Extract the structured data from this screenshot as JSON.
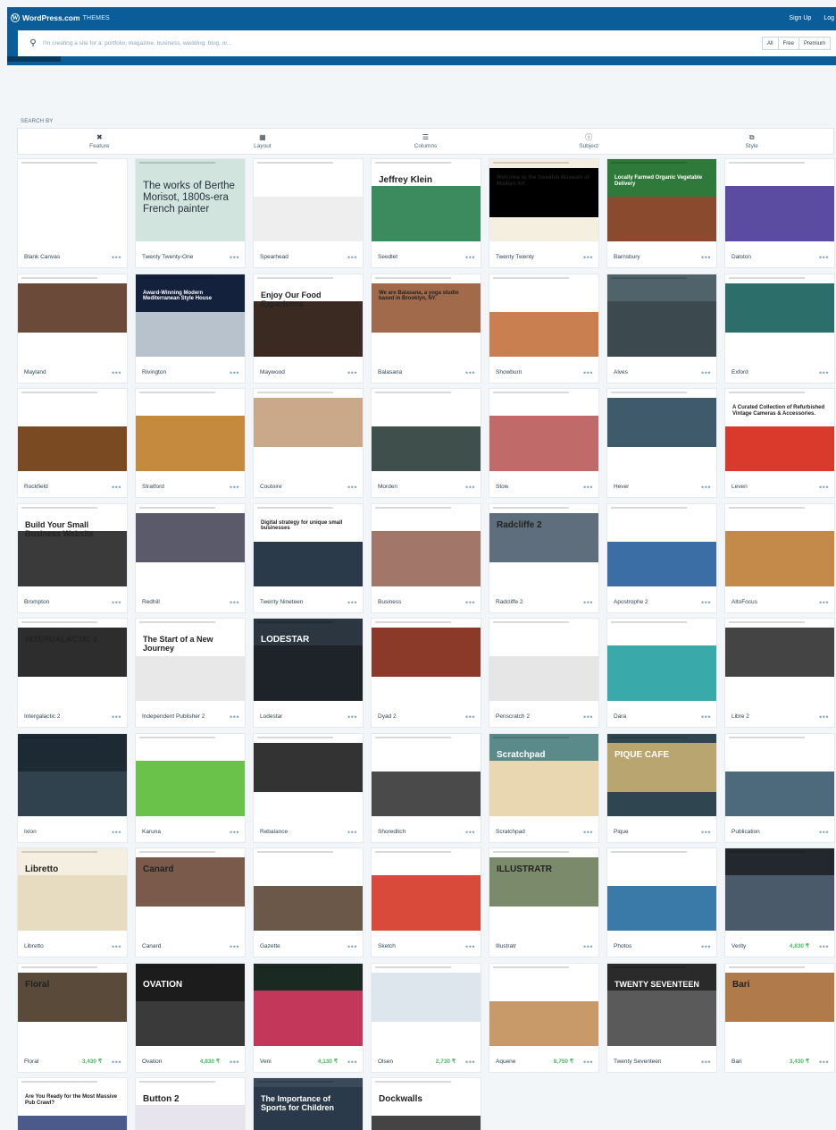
{
  "masthead": {
    "brand": "WordPress.com",
    "section": "THEMES",
    "links": [
      "Sign Up",
      "Log"
    ],
    "search_placeholder": "I'm creating a site for a: portfolio, magazine, business, wedding, blog, or...",
    "filters": [
      "All",
      "Free",
      "Premium"
    ]
  },
  "search_by": {
    "label": "SEARCH BY",
    "items": [
      {
        "label": "Feature",
        "icon": "tools-icon"
      },
      {
        "label": "Layout",
        "icon": "layout-icon"
      },
      {
        "label": "Columns",
        "icon": "columns-icon"
      },
      {
        "label": "Subject",
        "icon": "info-icon"
      },
      {
        "label": "Style",
        "icon": "style-icon"
      }
    ]
  },
  "themes": [
    {
      "name": "Blank Canvas",
      "price": "",
      "preview": {
        "bg": "#ffffff",
        "accent": "#ffffff"
      }
    },
    {
      "name": "Twenty Twenty-One",
      "price": "",
      "preview": {
        "bg": "#d1e4dd",
        "accent": "#d1e4dd",
        "text": "The works of Berthe Morisot, 1800s-era French painter"
      }
    },
    {
      "name": "Spearhead",
      "price": "",
      "preview": {
        "bg": "#ffffff",
        "accent": "#eeeeee"
      }
    },
    {
      "name": "Seedlet",
      "price": "",
      "preview": {
        "bg": "#ffffff",
        "accent": "#3c8b5f",
        "text": "Jeffrey Klein"
      }
    },
    {
      "name": "Twenty Twenty",
      "price": "",
      "preview": {
        "bg": "#f5efe0",
        "accent": "#000000",
        "text": "Welcome to the Swedish Museum of Modern Art"
      }
    },
    {
      "name": "Barnsbury",
      "price": "",
      "preview": {
        "bg": "#2f7a3b",
        "accent": "#8a4a2e",
        "text": "Locally Farmed Organic Vegetable Delivery"
      }
    },
    {
      "name": "Dalston",
      "price": "",
      "preview": {
        "bg": "#ffffff",
        "accent": "#5b4ba1"
      }
    },
    {
      "name": "Mayland",
      "price": "",
      "preview": {
        "bg": "#ffffff",
        "accent": "#6b4a3a"
      }
    },
    {
      "name": "Rivington",
      "price": "",
      "preview": {
        "bg": "#14213d",
        "accent": "#b8c2cc",
        "text": "Award-Winning Modern Mediterranean Style House"
      }
    },
    {
      "name": "Maywood",
      "price": "",
      "preview": {
        "bg": "#ffffff",
        "accent": "#3b2a22",
        "text": "Enjoy Our Food Experience"
      }
    },
    {
      "name": "Balasana",
      "price": "",
      "preview": {
        "bg": "#ffffff",
        "accent": "#a06a4b",
        "text": "We are Balasana, a yoga studio based in Brooklyn, NY."
      }
    },
    {
      "name": "Showburn",
      "price": "",
      "preview": {
        "bg": "#ffffff",
        "accent": "#c97f4f"
      }
    },
    {
      "name": "Alves",
      "price": "",
      "preview": {
        "bg": "#50626a",
        "accent": "#3c4a50"
      }
    },
    {
      "name": "Exford",
      "price": "",
      "preview": {
        "bg": "#ffffff",
        "accent": "#2c6e6a"
      }
    },
    {
      "name": "Rockfield",
      "price": "",
      "preview": {
        "bg": "#ffffff",
        "accent": "#7a4a22"
      }
    },
    {
      "name": "Stratford",
      "price": "",
      "preview": {
        "bg": "#ffffff",
        "accent": "#c58a3d"
      }
    },
    {
      "name": "Coutoire",
      "price": "",
      "preview": {
        "bg": "#ffffff",
        "accent": "#caa98a"
      }
    },
    {
      "name": "Morden",
      "price": "",
      "preview": {
        "bg": "#ffffff",
        "accent": "#3e4f4c"
      }
    },
    {
      "name": "Stow",
      "price": "",
      "preview": {
        "bg": "#ffffff",
        "accent": "#c06a6a"
      }
    },
    {
      "name": "Hever",
      "price": "",
      "preview": {
        "bg": "#ffffff",
        "accent": "#3f5a6b"
      }
    },
    {
      "name": "Leven",
      "price": "",
      "preview": {
        "bg": "#ffffff",
        "accent": "#d93a2b",
        "text": "A Curated Collection of Refurbished Vintage Cameras & Accessories."
      }
    },
    {
      "name": "Brompton",
      "price": "",
      "preview": {
        "bg": "#ffffff",
        "accent": "#3a3a3a",
        "text": "Build Your Small Business Website"
      }
    },
    {
      "name": "Redhill",
      "price": "",
      "preview": {
        "bg": "#ffffff",
        "accent": "#5a5a6a"
      }
    },
    {
      "name": "Twenty Nineteen",
      "price": "",
      "preview": {
        "bg": "#ffffff",
        "accent": "#2a3a4a",
        "text": "Digital strategy for unique small businesses"
      }
    },
    {
      "name": "Business",
      "price": "",
      "preview": {
        "bg": "#ffffff",
        "accent": "#a2776a"
      }
    },
    {
      "name": "Radcliffe 2",
      "price": "",
      "preview": {
        "bg": "#ffffff",
        "accent": "#5e6e7c",
        "text": "Radcliffe 2"
      }
    },
    {
      "name": "Apostrophe 2",
      "price": "",
      "preview": {
        "bg": "#ffffff",
        "accent": "#3a6ea5"
      }
    },
    {
      "name": "AltoFocus",
      "price": "",
      "preview": {
        "bg": "#ffffff",
        "accent": "#c48a4a"
      }
    },
    {
      "name": "Intergalactic 2",
      "price": "",
      "preview": {
        "bg": "#ffffff",
        "accent": "#2d2d2d",
        "text": "INTERGALACTIC 2"
      }
    },
    {
      "name": "Independent Publisher 2",
      "price": "",
      "preview": {
        "bg": "#ffffff",
        "accent": "#e8e8e8",
        "text": "The Start of a New Journey"
      }
    },
    {
      "name": "Lodestar",
      "price": "",
      "preview": {
        "bg": "#2b3640",
        "accent": "#1d2329",
        "text": "LODESTAR"
      }
    },
    {
      "name": "Dyad 2",
      "price": "",
      "preview": {
        "bg": "#ffffff",
        "accent": "#8b3a2a"
      }
    },
    {
      "name": "Penscratch 2",
      "price": "",
      "preview": {
        "bg": "#ffffff",
        "accent": "#e6e6e6"
      }
    },
    {
      "name": "Dara",
      "price": "",
      "preview": {
        "bg": "#ffffff",
        "accent": "#3aa9a9"
      }
    },
    {
      "name": "Libre 2",
      "price": "",
      "preview": {
        "bg": "#ffffff",
        "accent": "#444444"
      }
    },
    {
      "name": "Ixion",
      "price": "",
      "preview": {
        "bg": "#1d2a33",
        "accent": "#31424f"
      }
    },
    {
      "name": "Karuna",
      "price": "",
      "preview": {
        "bg": "#ffffff",
        "accent": "#6ac24a"
      }
    },
    {
      "name": "Rebalance",
      "price": "",
      "preview": {
        "bg": "#ffffff",
        "accent": "#333333"
      }
    },
    {
      "name": "Shoreditch",
      "price": "",
      "preview": {
        "bg": "#ffffff",
        "accent": "#4a4a4a"
      }
    },
    {
      "name": "Scratchpad",
      "price": "",
      "preview": {
        "bg": "#5a8a8a",
        "accent": "#e8d7b0",
        "text": "Scratchpad"
      }
    },
    {
      "name": "Pique",
      "price": "",
      "preview": {
        "bg": "#2f4550",
        "accent": "#b9a570",
        "text": "PIQUE CAFE"
      }
    },
    {
      "name": "Publication",
      "price": "",
      "preview": {
        "bg": "#ffffff",
        "accent": "#4c6a7b"
      }
    },
    {
      "name": "Libretto",
      "price": "",
      "preview": {
        "bg": "#f4efe0",
        "accent": "#e8dcc0",
        "text": "Libretto"
      }
    },
    {
      "name": "Canard",
      "price": "",
      "preview": {
        "bg": "#ffffff",
        "accent": "#7a5a4a",
        "text": "Canard"
      }
    },
    {
      "name": "Gazette",
      "price": "",
      "preview": {
        "bg": "#ffffff",
        "accent": "#6b5848"
      }
    },
    {
      "name": "Sketch",
      "price": "",
      "preview": {
        "bg": "#ffffff",
        "accent": "#d94a3a"
      }
    },
    {
      "name": "Illustratr",
      "price": "",
      "preview": {
        "bg": "#ffffff",
        "accent": "#7a8a6a",
        "text": "ILLUSTRATR"
      }
    },
    {
      "name": "Photos",
      "price": "",
      "preview": {
        "bg": "#ffffff",
        "accent": "#3a7aa8"
      }
    },
    {
      "name": "Verity",
      "price": "4,830 ₹",
      "preview": {
        "bg": "#22282e",
        "accent": "#4a5a6a"
      }
    },
    {
      "name": "Floral",
      "price": "3,430 ₹",
      "preview": {
        "bg": "#ffffff",
        "accent": "#5a4a3a",
        "text": "Floral"
      }
    },
    {
      "name": "Ovation",
      "price": "4,830 ₹",
      "preview": {
        "bg": "#1c1c1c",
        "accent": "#3a3a3a",
        "text": "OVATION"
      }
    },
    {
      "name": "Veni",
      "price": "4,130 ₹",
      "preview": {
        "bg": "#1a2a22",
        "accent": "#c2375a"
      }
    },
    {
      "name": "Olsen",
      "price": "2,730 ₹",
      "preview": {
        "bg": "#ffffff",
        "accent": "#dde6ec"
      }
    },
    {
      "name": "Aquene",
      "price": "8,750 ₹",
      "preview": {
        "bg": "#ffffff",
        "accent": "#c89a6a"
      }
    },
    {
      "name": "Twenty Seventeen",
      "price": "",
      "preview": {
        "bg": "#2a2a2a",
        "accent": "#5a5a5a",
        "text": "TWENTY SEVENTEEN"
      }
    },
    {
      "name": "Bari",
      "price": "3,430 ₹",
      "preview": {
        "bg": "#ffffff",
        "accent": "#b07a4a",
        "text": "Bari"
      }
    },
    {
      "name": "",
      "price": "",
      "preview": {
        "bg": "#ffffff",
        "accent": "#4a5a8a",
        "text": "Are You Ready for the Most Massive Pub Crawl?"
      }
    },
    {
      "name": "",
      "price": "",
      "preview": {
        "bg": "#ffffff",
        "accent": "#e8e4ee",
        "text": "Button 2"
      }
    },
    {
      "name": "",
      "price": "",
      "preview": {
        "bg": "#3a4a5a",
        "accent": "#2a3a4a",
        "text": "The Importance of Sports for Children"
      }
    },
    {
      "name": "",
      "price": "",
      "preview": {
        "bg": "#ffffff",
        "accent": "#444444",
        "text": "Dockwalls"
      }
    }
  ]
}
